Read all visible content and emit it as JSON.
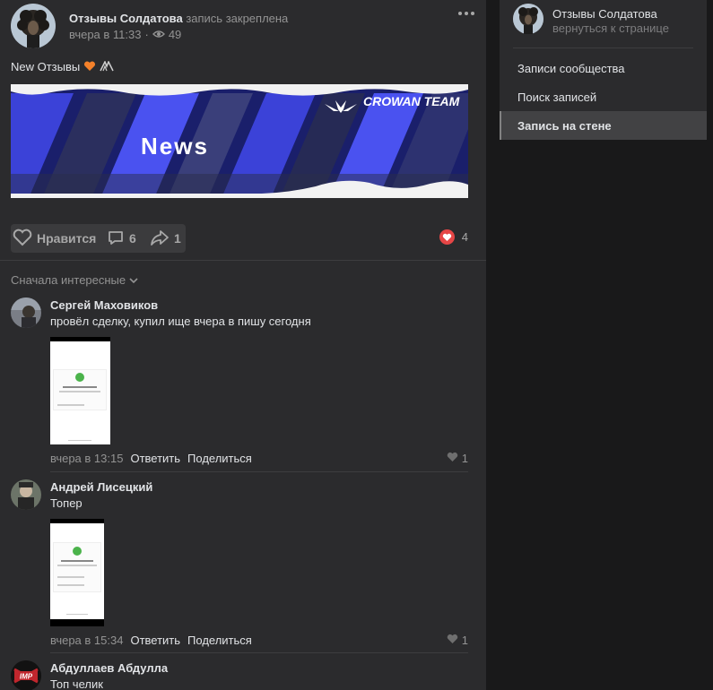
{
  "post": {
    "author": "Отзывы Солдатова",
    "pinned_label": "запись закреплена",
    "time": "вчера в 11:33",
    "views": "49",
    "text": "New Отзывы",
    "banner": {
      "team_label": "CROWAN TEAM",
      "headline": "News"
    },
    "like_label": "Нравится",
    "comments_count": "6",
    "shares_count": "1",
    "reactions_count": "4"
  },
  "sort_label": "Сначала интересные",
  "comments": [
    {
      "name": "Сергей Маховиков",
      "text": "провёл сделку, купил ище вчера в пишу сегодня",
      "time": "вчера в 13:15",
      "reply": "Ответить",
      "share": "Поделиться",
      "likes": "1"
    },
    {
      "name": "Андрей Лисецкий",
      "text": "Топер",
      "time": "вчера в 15:34",
      "reply": "Ответить",
      "share": "Поделиться",
      "likes": "1"
    },
    {
      "name": "Абдуллаев Абдулла",
      "text": "Топ челик",
      "avatar_text": "IMP"
    }
  ],
  "sidebar": {
    "name": "Отзывы Солдатова",
    "back": "вернуться к странице",
    "items": [
      {
        "label": "Записи сообщества"
      },
      {
        "label": "Поиск записей"
      },
      {
        "label": "Запись на стене"
      }
    ]
  },
  "colors": {
    "bg": "#19191a",
    "card": "#2b2b2d",
    "text": "#e1e3e6",
    "muted": "#939393",
    "like_red": "#e64646",
    "banner_blue": "#3b42d8",
    "check_green": "#4bb34b"
  }
}
